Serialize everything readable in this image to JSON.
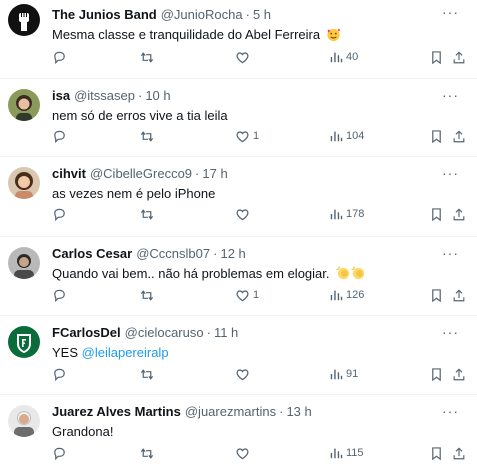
{
  "tweets": [
    {
      "name": "The Junios Band",
      "handle": "@JunioRocha",
      "time": "5 h",
      "text": "Mesma classe e tranquilidade do Abel Ferreira",
      "emoji": "smiling-hearts-emoji",
      "likes": "",
      "views": "40"
    },
    {
      "name": "isa",
      "handle": "@itssasep",
      "time": "10 h",
      "text": "nem só de erros vive a tia leila",
      "likes": "1",
      "views": "104"
    },
    {
      "name": "cihvit",
      "handle": "@CibelleGrecco9",
      "time": "17 h",
      "text": "as vezes nem é pelo iPhone",
      "likes": "",
      "views": "178"
    },
    {
      "name": "Carlos Cesar",
      "handle": "@Cccnslb07",
      "time": "12 h",
      "text": "Quando vai bem.. não há problemas em elogiar.",
      "emoji": "clapping-hands-emoji",
      "likes": "1",
      "views": "126"
    },
    {
      "name": "FCarlosDel",
      "handle": "@cielocaruso",
      "time": "11 h",
      "text": "YES",
      "mention": "@leilapereiralp",
      "likes": "",
      "views": "91"
    },
    {
      "name": "Juarez Alves Martins",
      "handle": "@juarezmartins",
      "time": "13 h",
      "text": "Grandona!",
      "likes": "",
      "views": "115"
    }
  ],
  "colors": {
    "text": "#0f1419",
    "muted": "#536471",
    "link": "#1d9bf0",
    "divider": "#eff3f4"
  }
}
